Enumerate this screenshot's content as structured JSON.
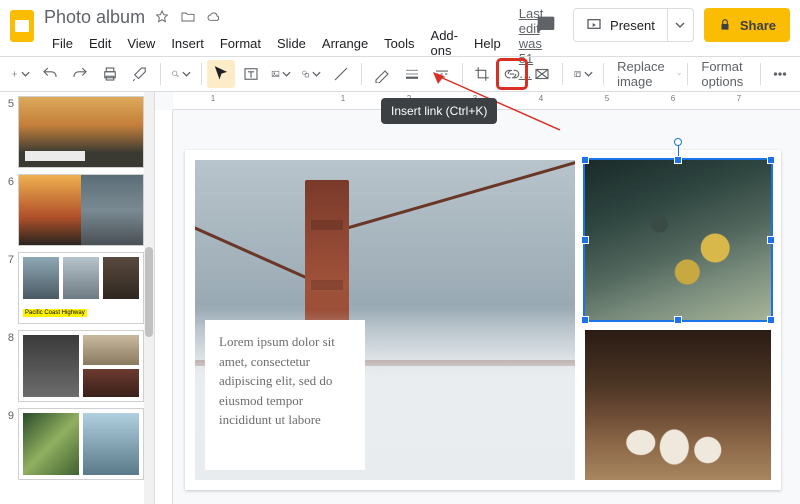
{
  "app": {
    "title": "Photo album"
  },
  "menus": {
    "file": "File",
    "edit": "Edit",
    "view": "View",
    "insert": "Insert",
    "format": "Format",
    "slide": "Slide",
    "arrange": "Arrange",
    "tools": "Tools",
    "addons": "Add-ons",
    "help": "Help",
    "last_edit": "Last edit was 51 …"
  },
  "titlebar_actions": {
    "present": "Present",
    "share": "Share"
  },
  "toolbar": {
    "replace_image": "Replace image",
    "format_options": "Format options",
    "tooltip_insert_link": "Insert link (Ctrl+K)"
  },
  "thumbnails": [
    {
      "n": "5",
      "kind": "t5"
    },
    {
      "n": "6",
      "kind": "t6"
    },
    {
      "n": "7",
      "kind": "t7",
      "caption": "Pacific Coast Highway"
    },
    {
      "n": "8",
      "kind": "t8"
    },
    {
      "n": "9",
      "kind": "t9"
    }
  ],
  "slide": {
    "textbox": "Lorem ipsum dolor sit amet, consectetur adipiscing elit, sed do eiusmod tempor incididunt ut labore"
  },
  "ruler": {
    "marks": [
      "1",
      "",
      "1",
      "2",
      "3",
      "4",
      "5",
      "6",
      "7"
    ]
  },
  "colors": {
    "accent": "#1a73e8",
    "share": "#fbbc04",
    "highlight": "#d93025"
  }
}
